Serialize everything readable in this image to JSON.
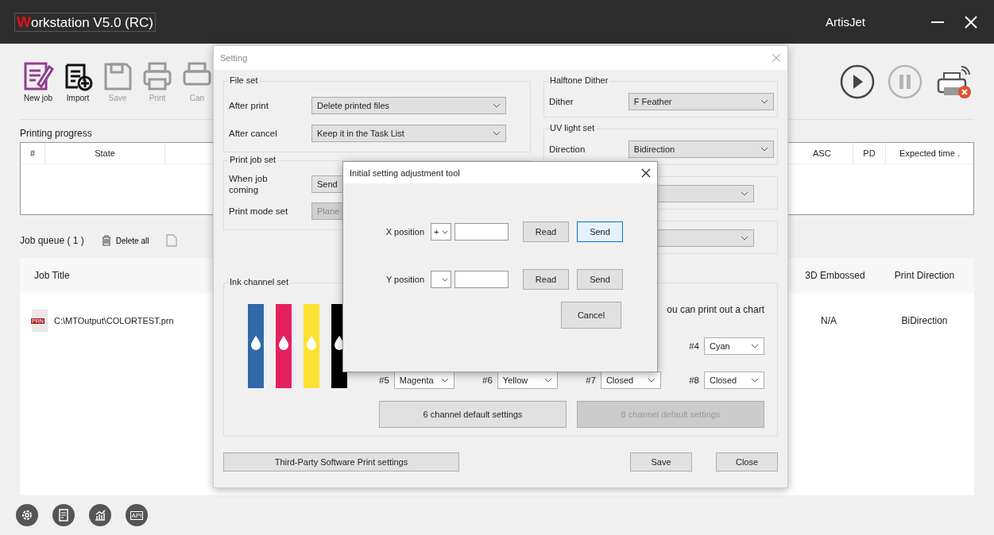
{
  "app": {
    "logo_letter": "W",
    "title": "orkstation V5.0 (RC)",
    "brand": "ArtisJet"
  },
  "toolbar": [
    {
      "kind": "new",
      "label": "New job",
      "disabled": false
    },
    {
      "kind": "import",
      "label": "Import",
      "disabled": false
    },
    {
      "kind": "save",
      "label": "Save",
      "disabled": true
    },
    {
      "kind": "print",
      "label": "Print",
      "disabled": true
    },
    {
      "kind": "cancel",
      "label": "Can",
      "disabled": true
    }
  ],
  "transport": [
    {
      "kind": "play",
      "disabled": false
    },
    {
      "kind": "pause",
      "disabled": true
    }
  ],
  "progress": {
    "title": "Printing progress",
    "columns_left": [
      "#",
      "State"
    ],
    "columns_right": [
      "ASC",
      "PD",
      "Expected time ."
    ]
  },
  "queue": {
    "title": "Job queue ( 1 )",
    "delete_all": "Delete all",
    "columns_left": [
      "Job Title"
    ],
    "columns_right": [
      "3D Embossed",
      "Print Direction"
    ],
    "rows": [
      {
        "badge": "PRN",
        "title": "C:\\MTOutput\\COLORTEST.prn",
        "cells_right": [
          "N/A",
          "BiDirection"
        ]
      }
    ]
  },
  "bottom_icons": [
    {
      "kind": "settings"
    },
    {
      "kind": "report"
    },
    {
      "kind": "chart"
    },
    {
      "kind": "api",
      "label": "API"
    }
  ],
  "setting": {
    "title": "Setting",
    "file_set": {
      "legend": "File set",
      "rows": [
        {
          "label": "After print",
          "value": "Delete printed files",
          "disabled": false
        },
        {
          "label": "After cancel",
          "value": "Keep it in the Task List",
          "disabled": false
        }
      ]
    },
    "print_job_set": {
      "legend": "Print job set",
      "rows": [
        {
          "label": "When job coming",
          "value": "Send",
          "disabled": false
        },
        {
          "label": "Print mode set",
          "value": "Plane",
          "disabled": true
        }
      ]
    },
    "halftone": {
      "legend": "Halftone Dither",
      "rows": [
        {
          "label": "Dither",
          "value": "F Feather",
          "disabled": false
        }
      ]
    },
    "uv": {
      "legend": "UV light set",
      "rows": [
        {
          "label": "Direction",
          "value": "Bidirection",
          "disabled": false
        }
      ]
    },
    "ink": {
      "legend": "Ink channel set",
      "inks": [
        {
          "color": "#2f69a8"
        },
        {
          "color": "#e4215f"
        },
        {
          "color": "#fbe232"
        },
        {
          "color": "#000000"
        }
      ],
      "note": "ou can print out a chart",
      "channel_4": {
        "label": "#4",
        "value": "Cyan"
      },
      "channels": [
        {
          "label": "#5",
          "value": "Magenta"
        },
        {
          "label": "#6",
          "value": "Yellow"
        },
        {
          "label": "#7",
          "value": "Closed"
        },
        {
          "label": "#8",
          "value": "Closed"
        }
      ],
      "buttons": [
        {
          "label": "6 channel default settings",
          "disabled": false
        },
        {
          "label": "8 channel default settings",
          "disabled": true
        }
      ]
    },
    "third_party": "Third-Party Software Print settings",
    "buttons": [
      "Save",
      "Close"
    ]
  },
  "adjust": {
    "title": "Initial setting adjustment tool",
    "rows": [
      {
        "label": "X position",
        "sign": "+",
        "read": "Read",
        "send": "Send",
        "send_focused": true
      },
      {
        "label": "Y position",
        "read": "Read",
        "send": "Send",
        "send_focused": false
      }
    ],
    "cancel": "Cancel"
  }
}
